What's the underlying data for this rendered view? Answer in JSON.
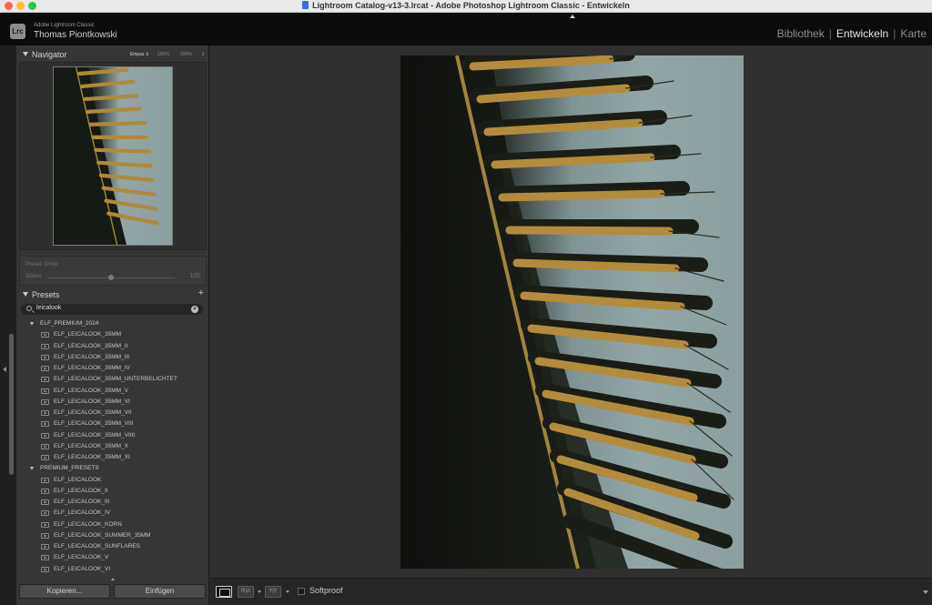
{
  "window": {
    "title": "Lightroom Catalog-v13-3.lrcat - Adobe Photoshop Lightroom Classic - Entwickeln"
  },
  "identity": {
    "logo": "Lrc",
    "brand_small": "Adobe Lightroom Classic",
    "user": "Thomas Piontkowski"
  },
  "modules": {
    "items": [
      "Bibliothek",
      "Entwickeln",
      "Karte"
    ],
    "active": "Entwickeln"
  },
  "navigator": {
    "title": "Navigator",
    "zoom": {
      "fit": "Einpas ⇕",
      "z100": "100%",
      "z200": "200%",
      "more": "⇕"
    }
  },
  "preset_amount": {
    "preset_label": "Preset: Ohne",
    "strength_label": "Stärke",
    "strength_value": "100",
    "strength_fraction": 0.5
  },
  "presets": {
    "title": "Presets",
    "add_symbol": "+",
    "search_value": "leicalook",
    "clear_symbol": "×",
    "groups": [
      {
        "name": "ELF_PREMIUM_2024",
        "items": [
          "ELF_LEICALOOK_35MM",
          "ELF_LEICALOOK_35MM_II",
          "ELF_LEICALOOK_35MM_III",
          "ELF_LEICALOOK_35MM_IV",
          "ELF_LEICALOOK_35MM_UNTERBELICHTET",
          "ELF_LEICALOOK_35MM_V",
          "ELF_LEICALOOK_35MM_VI",
          "ELF_LEICALOOK_35MM_VII",
          "ELF_LEICALOOK_35MM_VIII",
          "ELF_LEICALOOK_35MM_VIIII",
          "ELF_LEICALOOK_35MM_X",
          "ELF_LEICALOOK_35MM_XI"
        ]
      },
      {
        "name": "PREMIUM_PRESETS",
        "items": [
          "ELF_LEICALOOK",
          "ELF_LEICALOOK_II",
          "ELF_LEICALOOK_III",
          "ELF_LEICALOOK_IV",
          "ELF_LEICALOOK_KORN",
          "ELF_LEICALOOK_SUMMER_35MM",
          "ELF_LEICALOOK_SUNFLARES",
          "ELF_LEICALOOK_V",
          "ELF_LEICALOOK_VI"
        ]
      }
    ]
  },
  "buttons": {
    "copy": "Kopieren...",
    "paste": "Einfügen"
  },
  "toolbar": {
    "compare_ab": "R|A",
    "compare_yy": "Y|Y",
    "softproof": "Softproof"
  },
  "colors": {
    "background": "#2b2b2b",
    "panel": "#363636",
    "identity_bar": "#0c0c0c",
    "active_module": "#e6e6e6",
    "leaf_gold": "#b08a3a",
    "sky": "#8fa2a3"
  }
}
